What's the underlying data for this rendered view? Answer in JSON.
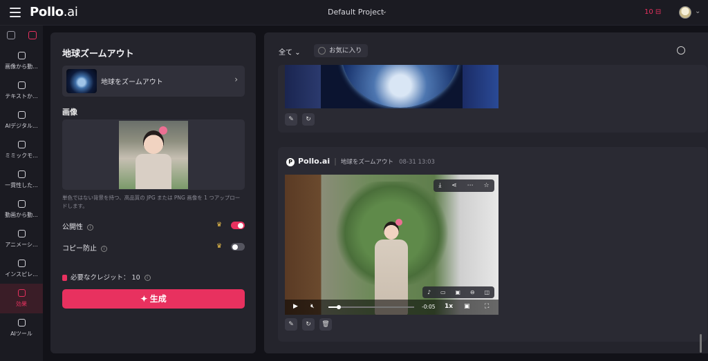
{
  "header": {
    "logo_main": "Pollo",
    "logo_suffix": ".ai",
    "project": "Default Project",
    "credits": "10"
  },
  "sidebar": {
    "items": [
      {
        "label": "画像から動..."
      },
      {
        "label": "テキストか..."
      },
      {
        "label": "AIデジタル..."
      },
      {
        "label": "ミミックモ..."
      },
      {
        "label": "一貫性した..."
      },
      {
        "label": "動画から動..."
      },
      {
        "label": "アニメーシ..."
      },
      {
        "label": "インスピレ..."
      },
      {
        "label": "効果"
      },
      {
        "label": "AIツール"
      }
    ]
  },
  "panel": {
    "title": "地球ズームアウト",
    "effect_label": "地球をズームアウト",
    "image_label": "画像",
    "hint": "単色ではない背景を持つ、高品質の JPG または PNG 画像を 1 つアップロードします。",
    "public_label": "公開性",
    "copy_protect_label": "コピー防止",
    "credit_required": "必要なクレジット： 10",
    "generate_label": "生成",
    "public_on": true,
    "copy_protect_on": false
  },
  "main": {
    "filter": "全て",
    "favorites": "お気に入り",
    "card2": {
      "brand": "Pollo.ai",
      "effect": "地球をズームアウト",
      "timestamp": "08-31 13:03"
    },
    "video": {
      "time": "-0:05",
      "speed": "1x",
      "progress": 0.12
    }
  },
  "colors": {
    "accent": "#e8315f",
    "panel_bg": "#24242c",
    "app_bg": "#121218"
  }
}
